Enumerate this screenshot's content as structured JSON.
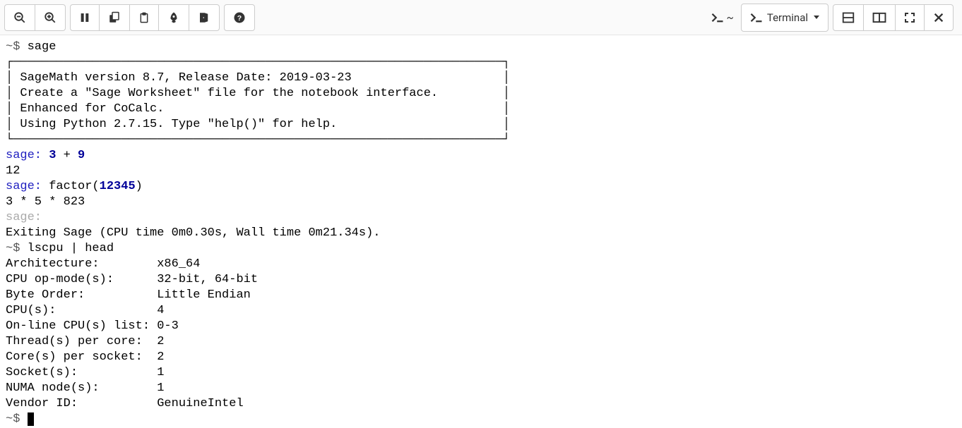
{
  "toolbar": {
    "path_indicator": "~",
    "dropdown_label": "Terminal"
  },
  "terminal": {
    "line_prompt1": "~$ ",
    "cmd_sage": "sage",
    "box_top": "┌────────────────────────────────────────────────────────────────────┐",
    "box_l1": "│ SageMath version 8.7, Release Date: 2019-03-23                     │",
    "box_l2": "│ Create a \"Sage Worksheet\" file for the notebook interface.         │",
    "box_l3": "│ Enhanced for CoCalc.                                               │",
    "box_l4": "│ Using Python 2.7.15. Type \"help()\" for help.                       │",
    "box_bot": "└────────────────────────────────────────────────────────────────────┘",
    "sage_prompt": "sage: ",
    "expr1_a": "3",
    "expr1_op": " + ",
    "expr1_b": "9",
    "res1": "12",
    "expr2_fn": "factor(",
    "expr2_arg": "12345",
    "expr2_close": ")",
    "res2": "3 * 5 * 823",
    "exit_msg": "Exiting Sage (CPU time 0m0.30s, Wall time 0m21.34s).",
    "line_prompt2": "~$ ",
    "cmd_lscpu": "lscpu | head",
    "cpu_l1": "Architecture:        x86_64",
    "cpu_l2": "CPU op-mode(s):      32-bit, 64-bit",
    "cpu_l3": "Byte Order:          Little Endian",
    "cpu_l4": "CPU(s):              4",
    "cpu_l5": "On-line CPU(s) list: 0-3",
    "cpu_l6": "Thread(s) per core:  2",
    "cpu_l7": "Core(s) per socket:  2",
    "cpu_l8": "Socket(s):           1",
    "cpu_l9": "NUMA node(s):        1",
    "cpu_l10": "Vendor ID:           GenuineIntel",
    "line_prompt3": "~$ "
  }
}
